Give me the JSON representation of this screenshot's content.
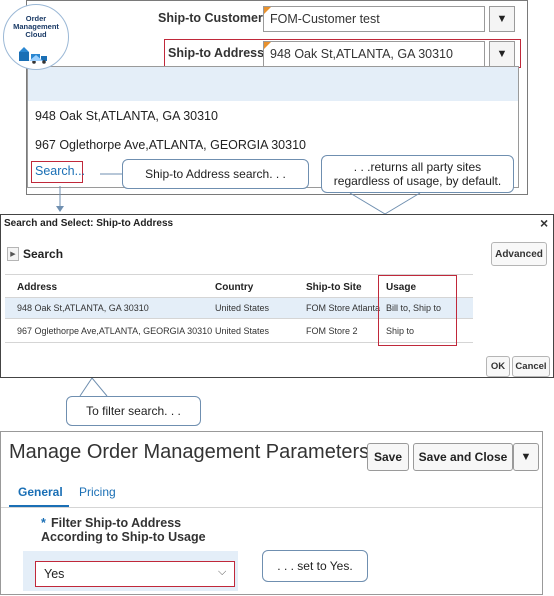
{
  "logo": {
    "text": "Order\nManagement\nCloud"
  },
  "order_form": {
    "ship_to_customer_label": "Ship-to Customer",
    "ship_to_customer_value": "FOM-Customer test",
    "ship_to_address_label": "Ship-to Address",
    "ship_to_address_value": "948 Oak St,ATLANTA, GA 30310",
    "dropdown_options": [
      "948 Oak St,ATLANTA, GA 30310",
      "967 Oglethorpe Ave,ATLANTA, GEORGIA 30310"
    ],
    "search_link": "Search..."
  },
  "callouts": {
    "address_search": "Ship-to Address search. . .",
    "returns_all": ". . .returns all party sites regardless  of usage, by default.",
    "filter_search": "To filter search. . .",
    "set_yes": ". . . set to Yes."
  },
  "search_dialog": {
    "title": "Search and Select: Ship-to Address",
    "close": "×",
    "search_label": "Search",
    "advanced_button": "Advanced",
    "columns": [
      "Address",
      "Country",
      "Ship-to Site",
      "Usage"
    ],
    "rows": [
      [
        "948 Oak St,ATLANTA, GA 30310",
        "United States",
        "FOM Store Atlanta",
        "Bill to, Ship to"
      ],
      [
        "967 Oglethorpe Ave,ATLANTA, GEORGIA 30310",
        "United States",
        "FOM Store 2",
        "Ship to"
      ]
    ],
    "ok_button": "OK",
    "cancel_button": "Cancel"
  },
  "parameters": {
    "title": "Manage Order Management Parameters",
    "save_button": "Save",
    "save_close_button": "Save and Close",
    "tabs": [
      "General",
      "Pricing"
    ],
    "field_required": "*",
    "field_label_line1": "Filter Ship-to Address",
    "field_label_line2": "According to Ship-to Usage",
    "field_value": "Yes"
  },
  "colors": {
    "highlight_border": "#c0283a",
    "selected_row": "#e4eef8",
    "accent": "#1a6fb5",
    "callout_border": "#6f8fb0"
  }
}
